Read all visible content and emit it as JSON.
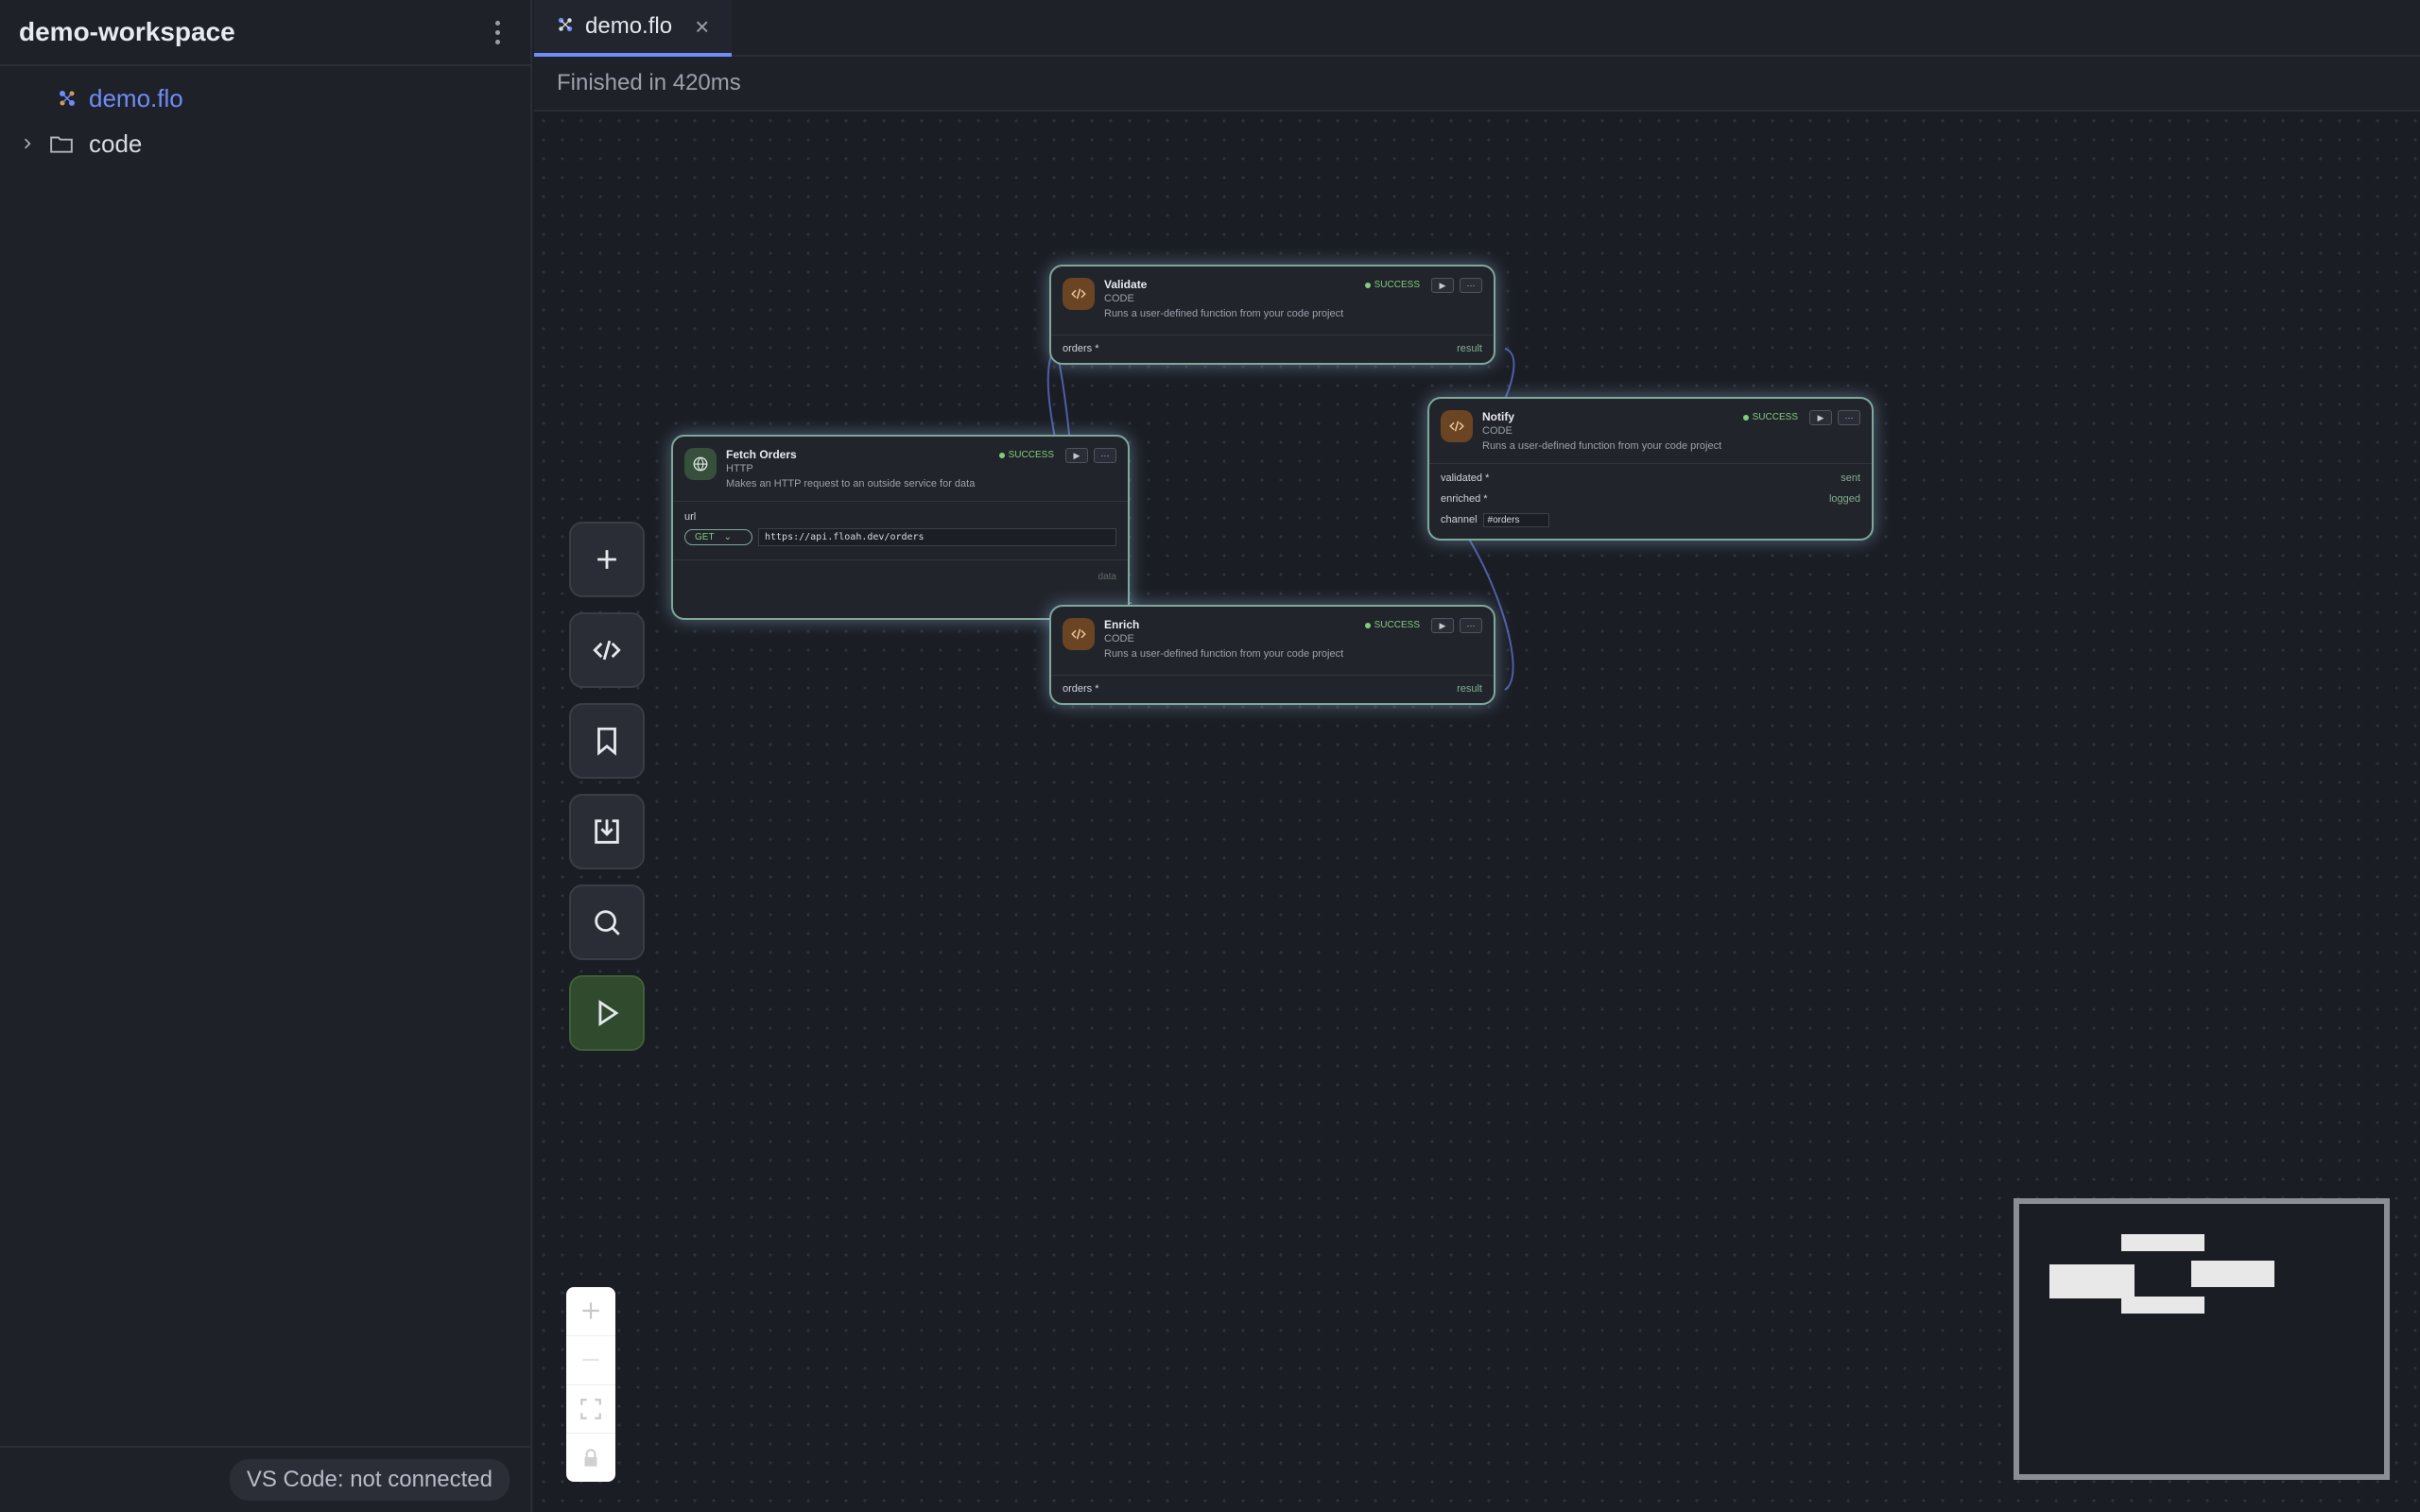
{
  "sidebar": {
    "title": "demo-workspace",
    "menu_icon": "kebab-menu-icon",
    "items": [
      {
        "label": "demo.flo",
        "icon": "flow-file-icon",
        "active": true
      },
      {
        "label": "code",
        "icon": "folder-icon",
        "expanded": false
      }
    ],
    "status": "VS Code: not connected"
  },
  "tabs": [
    {
      "label": "demo.flo",
      "icon": "flow-file-icon",
      "active": true
    }
  ],
  "run_status": "Finished in 420ms",
  "toolbar": {
    "items": [
      "add-node-icon",
      "code-icon",
      "bookmark-icon",
      "import-icon",
      "search-icon",
      "run-icon"
    ]
  },
  "zoom_controls": [
    "zoom-in-icon",
    "zoom-out-icon",
    "fit-view-icon",
    "lock-icon"
  ],
  "nodes": {
    "validate": {
      "name": "Validate",
      "type": "CODE",
      "description": "Runs a user-defined function from your code project",
      "status": "SUCCESS",
      "input": "orders *",
      "output": "result"
    },
    "fetch": {
      "name": "Fetch Orders",
      "type": "HTTP",
      "description": "Makes an HTTP request to an outside service for data",
      "status": "SUCCESS",
      "url_label": "url",
      "method": "GET",
      "url": "https://api.floah.dev/orders",
      "output": "data"
    },
    "notify": {
      "name": "Notify",
      "type": "CODE",
      "description": "Runs a user-defined function from your code project",
      "status": "SUCCESS",
      "input1": "validated *",
      "output1": "sent",
      "input2": "enriched *",
      "output2": "logged",
      "input3": "channel",
      "channel_value": "#orders"
    },
    "enrich": {
      "name": "Enrich",
      "type": "CODE",
      "description": "Runs a user-defined function from your code project",
      "status": "SUCCESS",
      "input": "orders *",
      "output": "result"
    }
  },
  "colors": {
    "accent": "#6f8cf7",
    "success": "#7fce7a",
    "node_border": "#7fa79a",
    "run_button": "#2f4a2c"
  }
}
